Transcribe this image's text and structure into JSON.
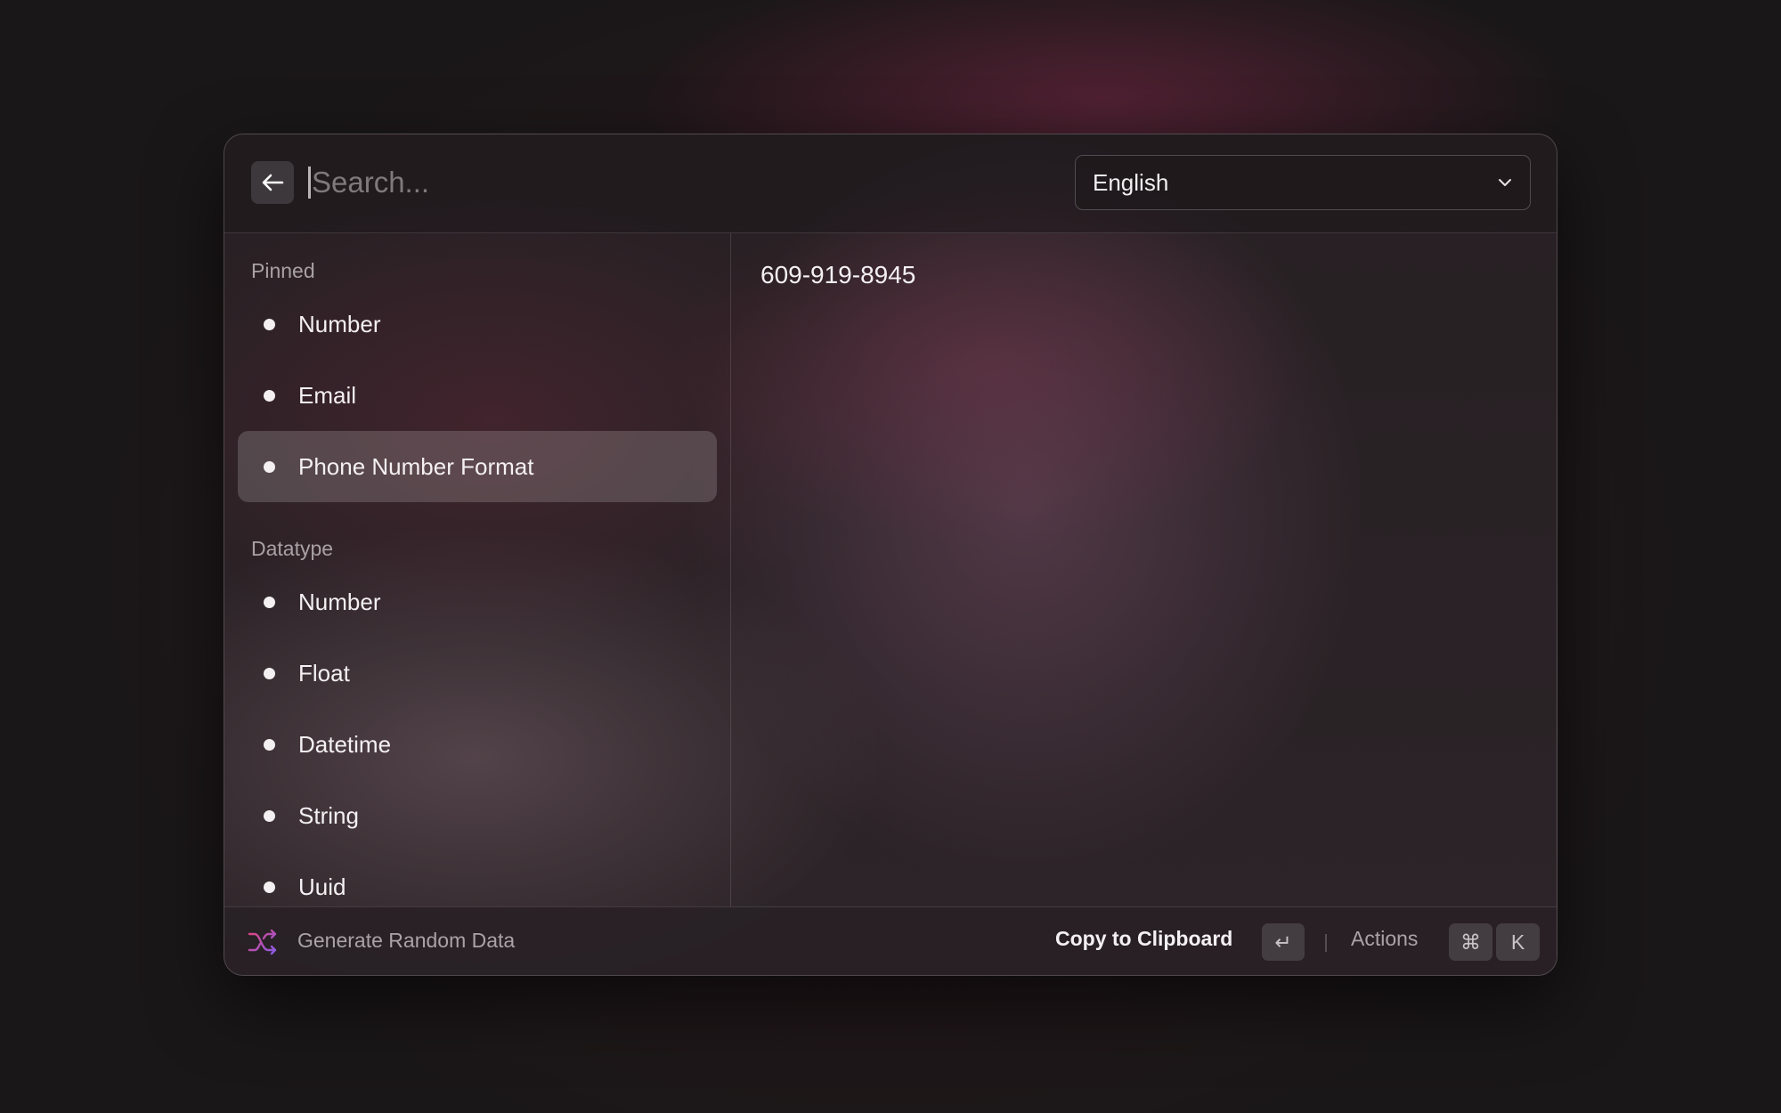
{
  "header": {
    "search_placeholder": "Search...",
    "search_value": "",
    "language": {
      "selected": "English"
    }
  },
  "sidebar": {
    "sections": [
      {
        "title": "Pinned",
        "items": [
          {
            "label": "Number"
          },
          {
            "label": "Email"
          },
          {
            "label": "Phone Number Format",
            "selected": true
          }
        ]
      },
      {
        "title": "Datatype",
        "items": [
          {
            "label": "Number"
          },
          {
            "label": "Float"
          },
          {
            "label": "Datetime"
          },
          {
            "label": "String"
          },
          {
            "label": "Uuid"
          }
        ]
      }
    ]
  },
  "main": {
    "preview_value": "609-919-8945"
  },
  "footer": {
    "title": "Generate Random Data",
    "primary_action": "Copy to Clipboard",
    "primary_shortcut": "↵",
    "actions_label": "Actions",
    "actions_shortcut_modifier": "⌘",
    "actions_shortcut_key": "K"
  },
  "icons": {
    "back": "arrow-left-icon",
    "dropdown": "chevron-down-icon",
    "bullet": "dot-icon",
    "footer": "shuffle-icon"
  },
  "colors": {
    "selected_row": "#5a4f54",
    "accent_shuffle_start": "#e0437e",
    "accent_shuffle_end": "#8a5ce8",
    "text_primary": "#f4f0f2",
    "text_muted": "#a8a1a4"
  }
}
